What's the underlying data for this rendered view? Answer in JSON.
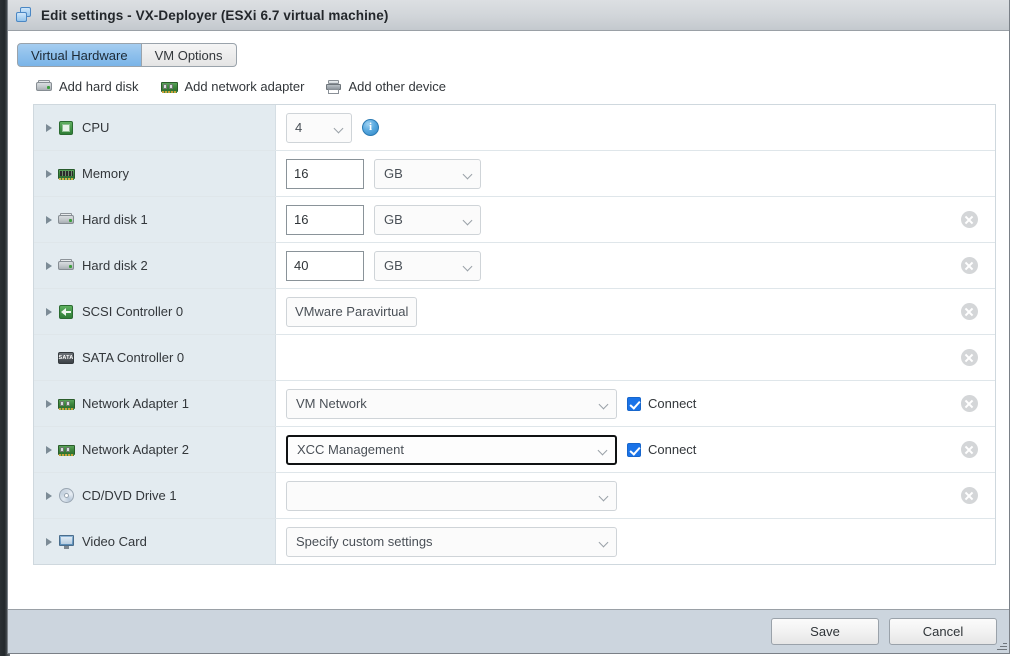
{
  "window": {
    "title": "Edit settings - VX-Deployer (ESXi 6.7 virtual machine)",
    "icon": "vm-windows-icon"
  },
  "tabs": [
    {
      "label": "Virtual Hardware",
      "active": true
    },
    {
      "label": "VM Options",
      "active": false
    }
  ],
  "toolbar": [
    {
      "label": "Add hard disk",
      "icon": "hard-disk-icon"
    },
    {
      "label": "Add network adapter",
      "icon": "network-adapter-icon"
    },
    {
      "label": "Add other device",
      "icon": "other-device-icon"
    }
  ],
  "devices": [
    {
      "name": "CPU",
      "icon": "cpu-icon",
      "expandable": true,
      "control": "dropdown",
      "value": "4",
      "info": "i",
      "removable": false
    },
    {
      "name": "Memory",
      "icon": "memory-icon",
      "expandable": true,
      "control": "number-unit",
      "value": "16",
      "unit": "GB",
      "removable": false
    },
    {
      "name": "Hard disk 1",
      "icon": "hard-disk-icon",
      "expandable": true,
      "control": "number-unit",
      "value": "16",
      "unit": "GB",
      "removable": true
    },
    {
      "name": "Hard disk 2",
      "icon": "hard-disk-icon",
      "expandable": true,
      "control": "number-unit",
      "value": "40",
      "unit": "GB",
      "removable": true
    },
    {
      "name": "SCSI Controller 0",
      "icon": "scsi-controller-icon",
      "expandable": true,
      "control": "readonly",
      "value": "VMware Paravirtual",
      "removable": true
    },
    {
      "name": "SATA Controller 0",
      "icon": "sata-controller-icon",
      "expandable": false,
      "control": "none",
      "value": "",
      "removable": true
    },
    {
      "name": "Network Adapter 1",
      "icon": "network-adapter-icon",
      "expandable": true,
      "control": "dropdown-wide",
      "value": "VM Network",
      "checkbox": {
        "label": "Connect",
        "checked": true
      },
      "removable": true
    },
    {
      "name": "Network Adapter 2",
      "icon": "network-adapter-icon",
      "expandable": true,
      "control": "dropdown-wide",
      "value": "XCC Management",
      "focused": true,
      "checkbox": {
        "label": "Connect",
        "checked": true
      },
      "removable": true
    },
    {
      "name": "CD/DVD Drive 1",
      "icon": "cd-dvd-icon",
      "expandable": true,
      "control": "dropdown-wide",
      "value": "",
      "removable": true
    },
    {
      "name": "Video Card",
      "icon": "video-card-icon",
      "expandable": true,
      "control": "dropdown-wide",
      "value": "Specify custom settings",
      "removable": false
    }
  ],
  "footer": {
    "save_label": "Save",
    "cancel_label": "Cancel"
  },
  "colors": {
    "accent": "#1a73e8",
    "tab_active": "#8ec0ec",
    "label_column": "#e3ebf0",
    "footer": "#ccd5de",
    "title_bar": "#d2d6da"
  }
}
